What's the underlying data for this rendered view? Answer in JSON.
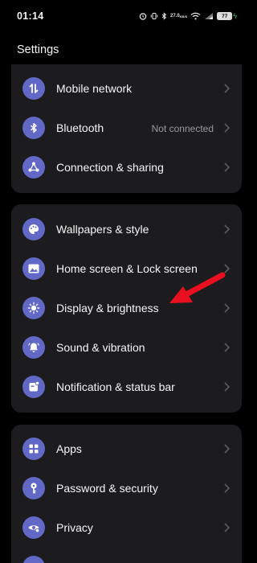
{
  "status_bar": {
    "time": "01:14",
    "net_speed_value": "27.0",
    "net_speed_unit": "KB/S",
    "battery": "77"
  },
  "header": {
    "title": "Settings"
  },
  "groups": [
    {
      "items": [
        {
          "label": "Mobile network",
          "icon": "mobile-data-icon"
        },
        {
          "label": "Bluetooth",
          "value": "Not connected",
          "icon": "bluetooth-icon"
        },
        {
          "label": "Connection & sharing",
          "icon": "share-icon"
        }
      ]
    },
    {
      "items": [
        {
          "label": "Wallpapers & style",
          "icon": "palette-icon"
        },
        {
          "label": "Home screen & Lock screen",
          "icon": "image-icon"
        },
        {
          "label": "Display & brightness",
          "icon": "brightness-icon"
        },
        {
          "label": "Sound & vibration",
          "icon": "bell-icon"
        },
        {
          "label": "Notification & status bar",
          "icon": "notification-icon"
        }
      ]
    },
    {
      "items": [
        {
          "label": "Apps",
          "icon": "apps-grid-icon"
        },
        {
          "label": "Password & security",
          "icon": "key-icon"
        },
        {
          "label": "Privacy",
          "icon": "privacy-eye-icon"
        }
      ]
    }
  ],
  "colors": {
    "background": "#000000",
    "card": "#1c1c1e",
    "icon_bg": "#6168c5",
    "annotation_arrow": "#e8101e"
  }
}
